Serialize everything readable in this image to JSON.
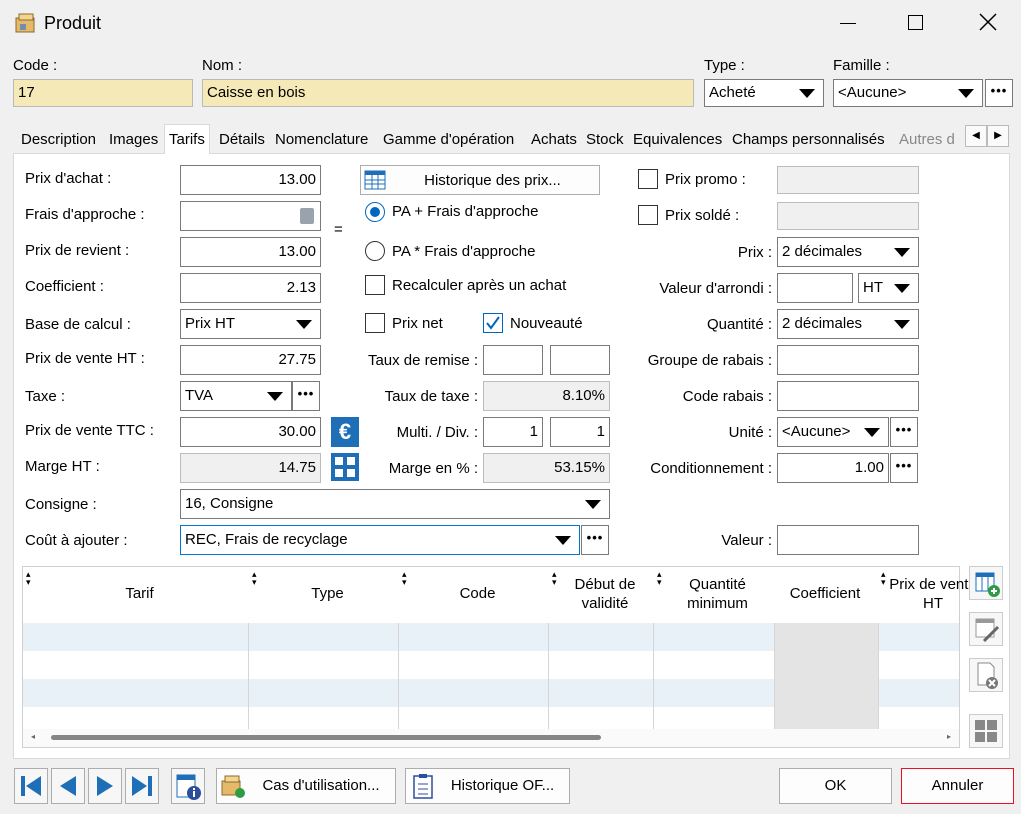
{
  "window": {
    "title": "Produit"
  },
  "header": {
    "code_label": "Code :",
    "code_value": "17",
    "nom_label": "Nom :",
    "nom_value": "Caisse en bois",
    "type_label": "Type :",
    "type_value": "Acheté",
    "famille_label": "Famille :",
    "famille_value": "<Aucune>"
  },
  "tabs": [
    "Description",
    "Images",
    "Tarifs",
    "Détails",
    "Nomenclature",
    "Gamme d'opération",
    "Achats",
    "Stock",
    "Equivalences",
    "Champs personnalisés",
    "Autres d"
  ],
  "active_tab": "Tarifs",
  "left": {
    "prix_achat_label": "Prix d'achat :",
    "prix_achat": "13.00",
    "frais_label": "Frais d'approche :",
    "frais": "",
    "prix_revient_label": "Prix de revient :",
    "prix_revient": "13.00",
    "coef_label": "Coefficient :",
    "coef": "2.13",
    "base_label": "Base de calcul :",
    "base": "Prix HT",
    "pv_ht_label": "Prix de vente HT :",
    "pv_ht": "27.75",
    "taxe_label": "Taxe :",
    "taxe": "TVA",
    "pv_ttc_label": "Prix de vente TTC :",
    "pv_ttc": "30.00",
    "marge_label": "Marge HT :",
    "marge": "14.75",
    "consigne_label": "Consigne :",
    "consigne": "16, Consigne",
    "cout_label": "Coût à ajouter :",
    "cout": "REC, Frais de recyclage"
  },
  "middle": {
    "historique_btn": "Historique des prix...",
    "equals": "=",
    "radio1": "PA + Frais d'approche",
    "radio2": "PA * Frais d'approche",
    "recalc": "Recalculer après un achat",
    "prix_net": "Prix net",
    "nouveaute": "Nouveauté",
    "remise_label": "Taux de remise :",
    "remise1": "",
    "remise2": "",
    "taxe_rate_label": "Taux de taxe :",
    "taxe_rate": "8.10%",
    "multi_label": "Multi. / Div. :",
    "multi": "1",
    "div": "1",
    "marge_pct_label": "Marge en % :",
    "marge_pct": "53.15%"
  },
  "right": {
    "promo_label": "Prix promo :",
    "promo": "",
    "solde_label": "Prix soldé :",
    "solde": "",
    "prix_label": "Prix :",
    "prix": "2 décimales",
    "arrondi_label": "Valeur d'arrondi :",
    "arrondi": "",
    "arrondi_mode": "HT",
    "quantite_label": "Quantité :",
    "quantite": "2 décimales",
    "groupe_label": "Groupe de rabais :",
    "groupe": "",
    "code_rabais_label": "Code rabais :",
    "code_rabais": "",
    "unite_label": "Unité :",
    "unite": "<Aucune>",
    "cond_label": "Conditionnement :",
    "cond": "1.00",
    "valeur_label": "Valeur :",
    "valeur": ""
  },
  "grid": {
    "columns": [
      "Tarif",
      "Type",
      "Code",
      "Début de validité",
      "Quantité minimum",
      "Coefficient",
      "Prix de vente HT"
    ]
  },
  "footer": {
    "cas_btn": "Cas d'utilisation...",
    "hist_of_btn": "Historique OF...",
    "ok_btn": "OK",
    "annuler_btn": "Annuler"
  },
  "colors": {
    "accent": "#0078d7",
    "yellow_field": "#f5e9b8",
    "cancel_border": "#e81123",
    "nav_blue": "#1e6fb8"
  }
}
